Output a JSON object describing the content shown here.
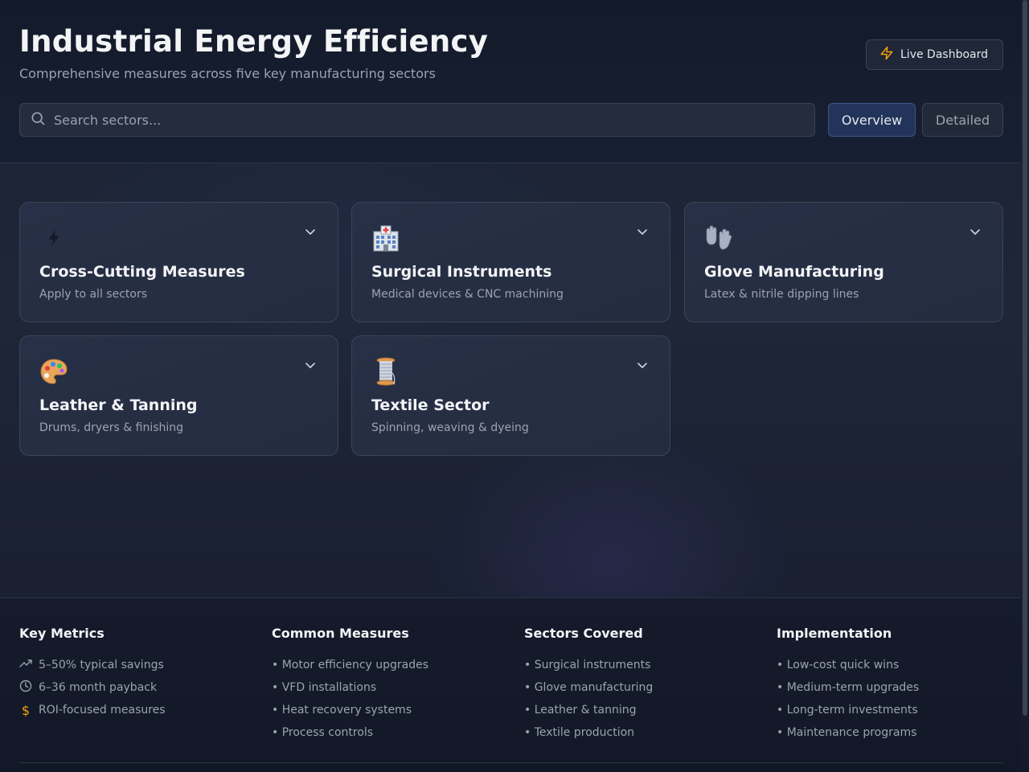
{
  "header": {
    "title": "Industrial Energy Efficiency",
    "subtitle": "Comprehensive measures across five key manufacturing sectors",
    "live_button_label": "Live Dashboard",
    "accent_color": "#f59e0b"
  },
  "search": {
    "placeholder": "Search sectors...",
    "value": ""
  },
  "view_toggle": {
    "options": [
      "Overview",
      "Detailed"
    ],
    "selected": "Overview"
  },
  "sectors": [
    {
      "icon": "lightning-icon",
      "glyph": "⚡",
      "name": "Cross-Cutting Measures",
      "description": "Apply to all sectors"
    },
    {
      "icon": "hospital-icon",
      "glyph": "🏥",
      "name": "Surgical Instruments",
      "description": "Medical devices & CNC machining"
    },
    {
      "icon": "gloves-icon",
      "glyph": "🧤",
      "name": "Glove Manufacturing",
      "description": "Latex & nitrile dipping lines"
    },
    {
      "icon": "palette-icon",
      "glyph": "🎨",
      "name": "Leather & Tanning",
      "description": "Drums, dryers & finishing"
    },
    {
      "icon": "thread-spool-icon",
      "glyph": "🧵",
      "name": "Textile Sector",
      "description": "Spinning, weaving & dyeing"
    }
  ],
  "footer": {
    "key_metrics": {
      "title": "Key Metrics",
      "items": [
        {
          "icon": "trending-up-icon",
          "text": "5–50% typical savings"
        },
        {
          "icon": "clock-icon",
          "text": "6–36 month payback"
        },
        {
          "icon": "dollar-icon",
          "text": "ROI-focused measures"
        }
      ]
    },
    "common_measures": {
      "title": "Common Measures",
      "items": [
        "• Motor efficiency upgrades",
        "• VFD installations",
        "• Heat recovery systems",
        "• Process controls"
      ]
    },
    "sectors_covered": {
      "title": "Sectors Covered",
      "items": [
        "• Surgical instruments",
        "• Glove manufacturing",
        "• Leather & tanning",
        "• Textile production"
      ]
    },
    "implementation": {
      "title": "Implementation",
      "items": [
        "• Low-cost quick wins",
        "• Medium-term upgrades",
        "• Long-term investments",
        "• Maintenance programs"
      ]
    }
  }
}
